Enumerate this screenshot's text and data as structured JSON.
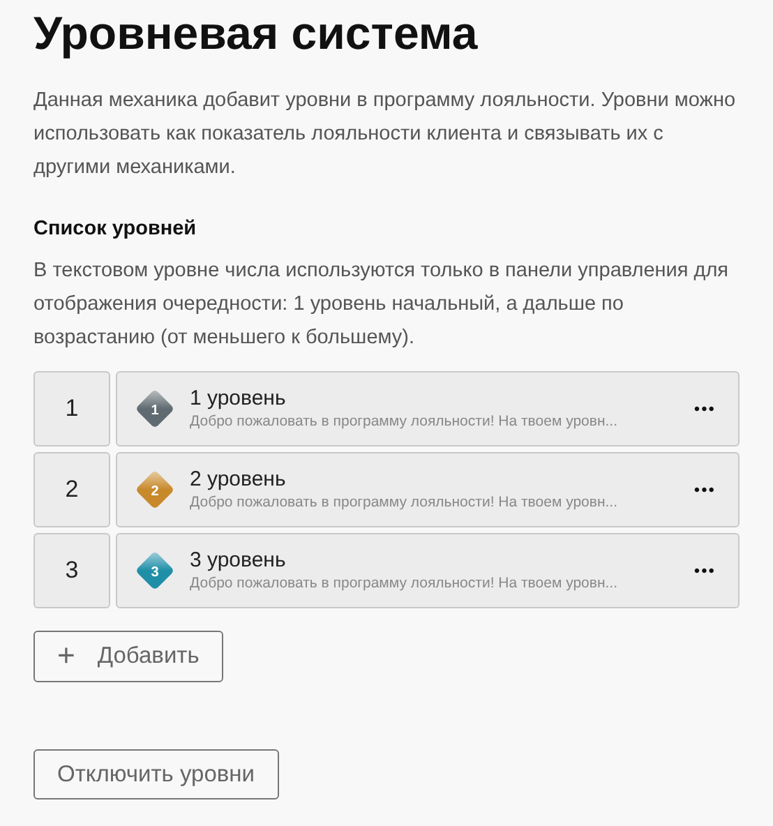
{
  "title": "Уровневая система",
  "description": "Данная механика добавит уровни в программу лояльности. Уровни можно использовать как показатель лояльности клиента и связывать их с другими механиками.",
  "section_title": "Список уровней",
  "section_note": "В текстовом уровне числа используются только в панели управления для отображения очередности: 1 уровень начальный, а дальше по возрастанию (от меньшего к большему).",
  "levels": [
    {
      "order": "1",
      "badge_label": "1",
      "color": "#5f6b70",
      "name": "1 уровень",
      "subtitle": "Добро пожаловать в программу лояльности! На твоем уровн...",
      "menu": "•••"
    },
    {
      "order": "2",
      "badge_label": "2",
      "color": "#c8892a",
      "name": "2 уровень",
      "subtitle": "Добро пожаловать в программу лояльности! На твоем уровн...",
      "menu": "•••"
    },
    {
      "order": "3",
      "badge_label": "3",
      "color": "#1f8fa8",
      "name": "3 уровень",
      "subtitle": "Добро пожаловать в программу лояльности! На твоем уровн...",
      "menu": "•••"
    }
  ],
  "add_button": {
    "icon": "+",
    "label": "Добавить"
  },
  "disable_button": "Отключить уровни"
}
